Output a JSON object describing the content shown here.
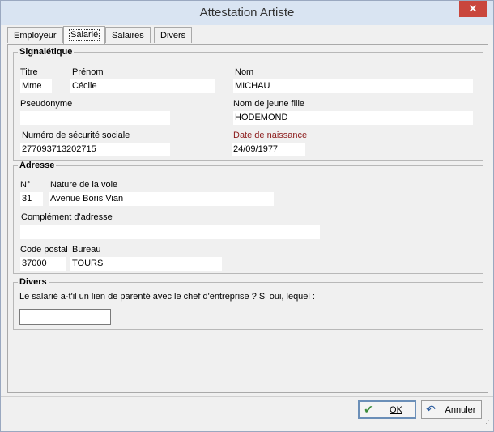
{
  "window": {
    "title": "Attestation Artiste",
    "close_glyph": "✕"
  },
  "tabs": [
    {
      "label": "Employeur",
      "active": false
    },
    {
      "label": "Salarié",
      "active": true
    },
    {
      "label": "Salaires",
      "active": false
    },
    {
      "label": "Divers",
      "active": false
    }
  ],
  "signaletique": {
    "legend": "Signalétique",
    "titre": {
      "label": "Titre",
      "value": "Mme"
    },
    "prenom": {
      "label": "Prénom",
      "value": "Cécile"
    },
    "nom": {
      "label": "Nom",
      "value": "MICHAU"
    },
    "pseudonyme": {
      "label": "Pseudonyme",
      "value": ""
    },
    "nom_jeune_fille": {
      "label": "Nom de jeune fille",
      "value": "HODEMOND"
    },
    "num_secu": {
      "label": "Numéro de sécurité sociale",
      "value": "277093713202715"
    },
    "date_naissance": {
      "label": "Date de naissance",
      "value": "24/09/1977"
    }
  },
  "adresse": {
    "legend": "Adresse",
    "numero": {
      "label": "N°",
      "value": "31"
    },
    "nature_voie": {
      "label": "Nature de la voie",
      "value": "Avenue Boris Vian"
    },
    "complement": {
      "label": "Complément d'adresse",
      "value": ""
    },
    "code_postal": {
      "label": "Code postal",
      "value": "37000"
    },
    "bureau": {
      "label": "Bureau",
      "value": "TOURS"
    }
  },
  "divers": {
    "legend": "Divers",
    "question": "Le salarié a-t'il un lien de parenté avec le chef d'entreprise ? Si oui, lequel :",
    "value": ""
  },
  "buttons": {
    "ok": {
      "label": "OK",
      "icon": "check-icon",
      "color": "#3c8d3c"
    },
    "annuler": {
      "label": "Annuler",
      "icon": "undo-icon",
      "color": "#2f5fa0"
    }
  }
}
